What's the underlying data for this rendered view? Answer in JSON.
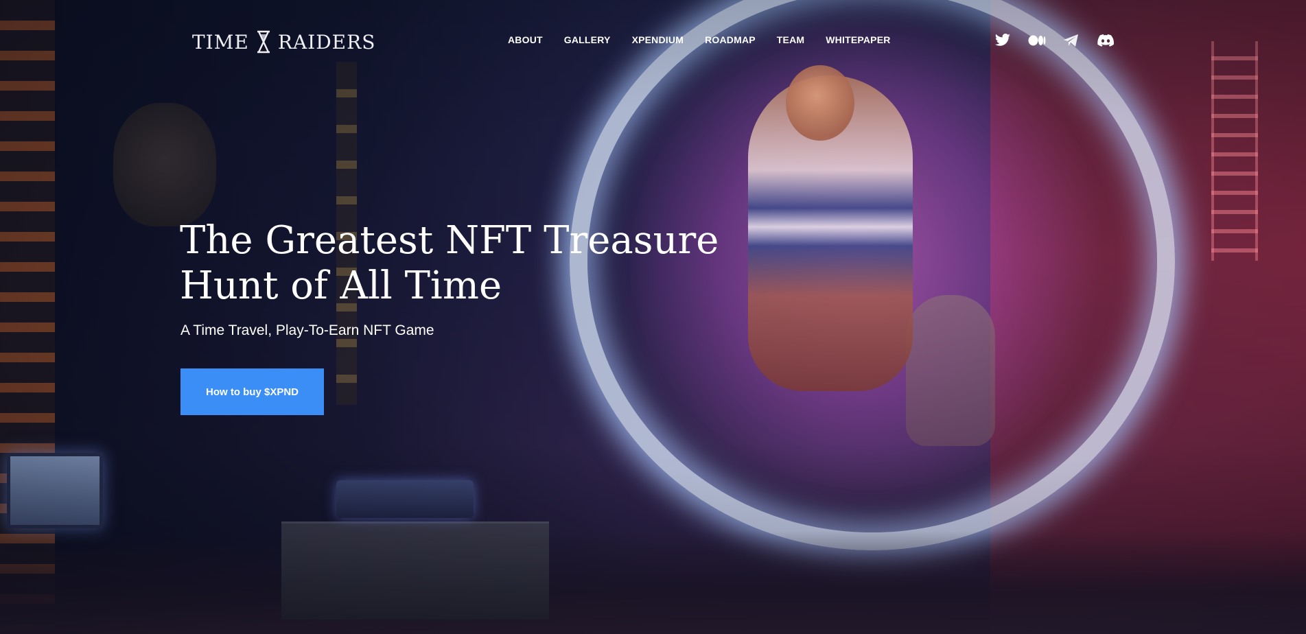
{
  "brand": {
    "logo_left": "TIME",
    "logo_right": "RAIDERS"
  },
  "nav": {
    "items": [
      {
        "label": "ABOUT"
      },
      {
        "label": "GALLERY"
      },
      {
        "label": "XPENDIUM"
      },
      {
        "label": "ROADMAP"
      },
      {
        "label": "TEAM"
      },
      {
        "label": "WHITEPAPER"
      }
    ]
  },
  "social": {
    "icons": [
      "twitter-icon",
      "medium-icon",
      "telegram-icon",
      "discord-icon"
    ]
  },
  "hero": {
    "title_line1": "The Greatest NFT Treasure",
    "title_line2": "Hunt of All Time",
    "subtitle": "A Time Travel, Play-To-Earn NFT Game",
    "cta_label": "How to buy $XPND"
  },
  "colors": {
    "cta_background": "#3a8ef6",
    "text": "#ffffff"
  }
}
